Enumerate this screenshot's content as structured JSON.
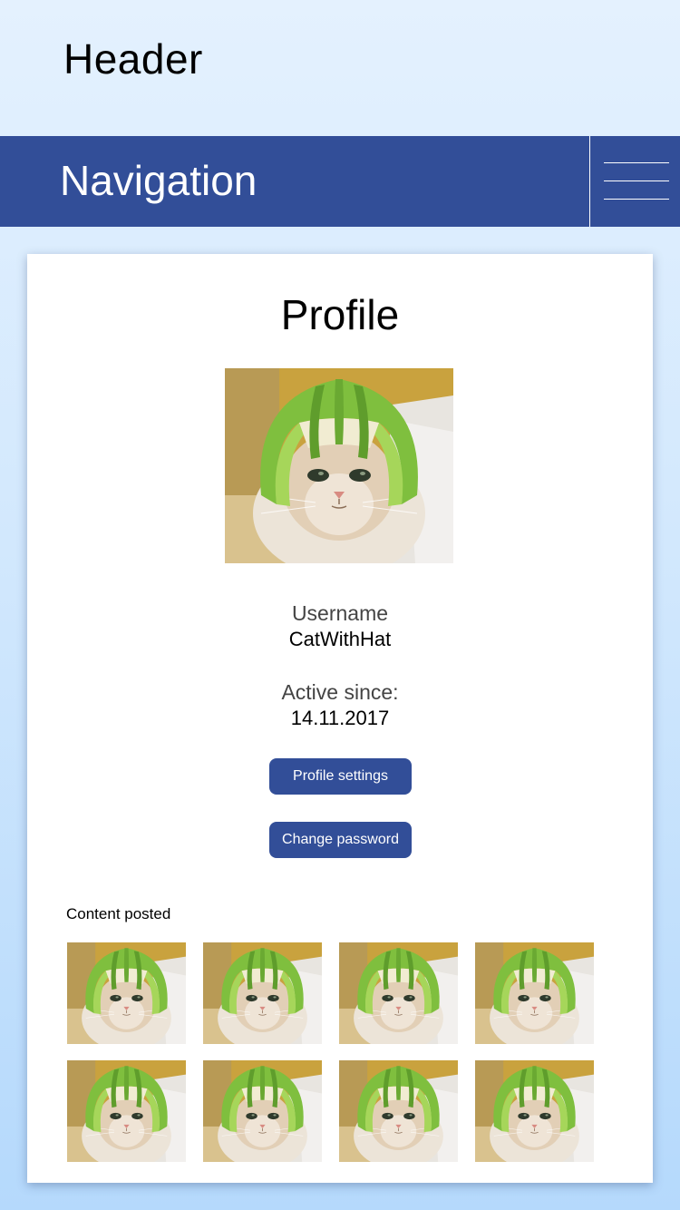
{
  "header": {
    "title": "Header"
  },
  "navigation": {
    "title": "Navigation",
    "menu_icon": "hamburger-menu-icon"
  },
  "profile": {
    "title": "Profile",
    "avatar_icon": "profile-photo",
    "username_label": "Username",
    "username_value": "CatWithHat",
    "active_since_label": "Active since:",
    "active_since_value": "14.11.2017",
    "buttons": {
      "settings_label": "Profile settings",
      "password_label": "Change password"
    }
  },
  "content": {
    "title": "Content posted",
    "thumbnail_count_shown": 8
  },
  "colors": {
    "nav_background": "#324e98",
    "button_background": "#324e98",
    "card_background": "#ffffff"
  }
}
